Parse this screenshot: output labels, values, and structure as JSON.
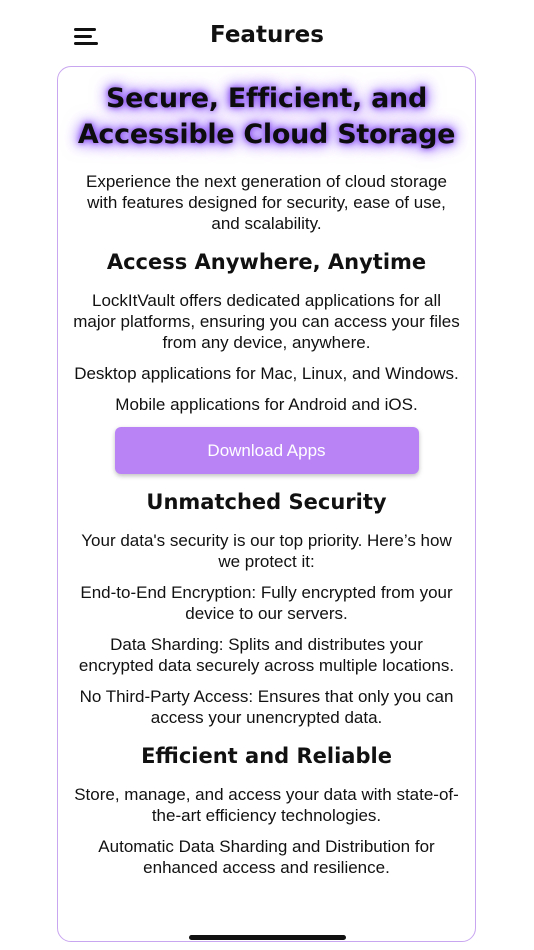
{
  "header": {
    "title": "Features",
    "menu_icon": "menu-icon"
  },
  "hero": {
    "title": "Secure, Efficient, and Accessible Cloud Storage",
    "intro": "Experience the next generation of cloud storage with features designed for security, ease of use, and scalability."
  },
  "access": {
    "heading": "Access Anywhere, Anytime",
    "p1": "LockItVault offers dedicated applications for all major platforms, ensuring you can access your files from any device, anywhere.",
    "p2": "Desktop applications for Mac, Linux, and Windows.",
    "p3": "Mobile applications for Android and iOS.",
    "button_label": "Download Apps"
  },
  "security": {
    "heading": "Unmatched Security",
    "p1": "Your data's security is our top priority. Here’s how we protect it:",
    "p2": "End-to-End Encryption: Fully encrypted from your device to our servers.",
    "p3": "Data Sharding: Splits and distributes your encrypted data securely across multiple locations.",
    "p4": "No Third-Party Access: Ensures that only you can access your unencrypted data."
  },
  "efficiency": {
    "heading": "Efficient and Reliable",
    "p1": "Store, manage, and access your data with state-of-the-art efficiency technologies.",
    "p2": "Automatic Data Sharding and Distribution for enhanced access and resilience."
  },
  "colors": {
    "accent": "#b983f6",
    "card_border": "#c9a6f0",
    "glow": "#8a4fff"
  }
}
